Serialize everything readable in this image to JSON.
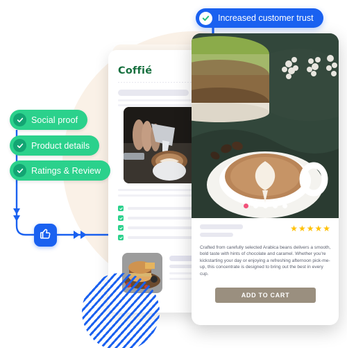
{
  "decor": {
    "circle_color": "#FAF1E7",
    "stripe_color": "#1A61F0",
    "flow_color": "#1A61F0"
  },
  "top_pill": {
    "label": "Increased customer trust",
    "icon": "check-circle-icon",
    "bg_color": "#1A61F0",
    "text_color": "#FFFFFF"
  },
  "badges": [
    {
      "label": "Social proof",
      "icon": "check-circle-icon",
      "bg_color": "#2BD18C",
      "icon_bg": "#13A573"
    },
    {
      "label": "Product details",
      "icon": "check-circle-icon",
      "bg_color": "#2BD18C",
      "icon_bg": "#13A573"
    },
    {
      "label": "Ratings & Review",
      "icon": "check-circle-icon",
      "bg_color": "#2BD18C",
      "icon_bg": "#13A573"
    }
  ],
  "thumb_node": {
    "icon": "thumbs-up-icon",
    "bg_color": "#1A61F0"
  },
  "product_page": {
    "title": "Coffié",
    "title_color": "#17703F",
    "hero_image_alt": "barista-pouring-latte-art",
    "thumbnail_alt": "burger-plate-photo",
    "checklist_count": 4,
    "placeholder_line_color": "#E8E8F0"
  },
  "product_card": {
    "hero_image_alt": "latte-art-cup-on-green-cloth",
    "carousel": {
      "total_dots": 5,
      "active_index": 0,
      "active_color": "#F2527B",
      "inactive_color": "#FFFFFF"
    },
    "rating": {
      "stars_filled": 5,
      "stars_total": 5,
      "star_glyph": "★",
      "star_color": "#FFC107"
    },
    "description": "Crafted from carefully selected Arabica beans delivers a smooth, bold taste with hints of chocolate and caramel. Whether you're kickstarting your day or enjoying a refreshing afternoon pick-me-up, this concentrate is designed to bring out the best in every cup.",
    "add_to_cart_label": "ADD TO CART",
    "add_to_cart_color": "#9A8F7F"
  }
}
